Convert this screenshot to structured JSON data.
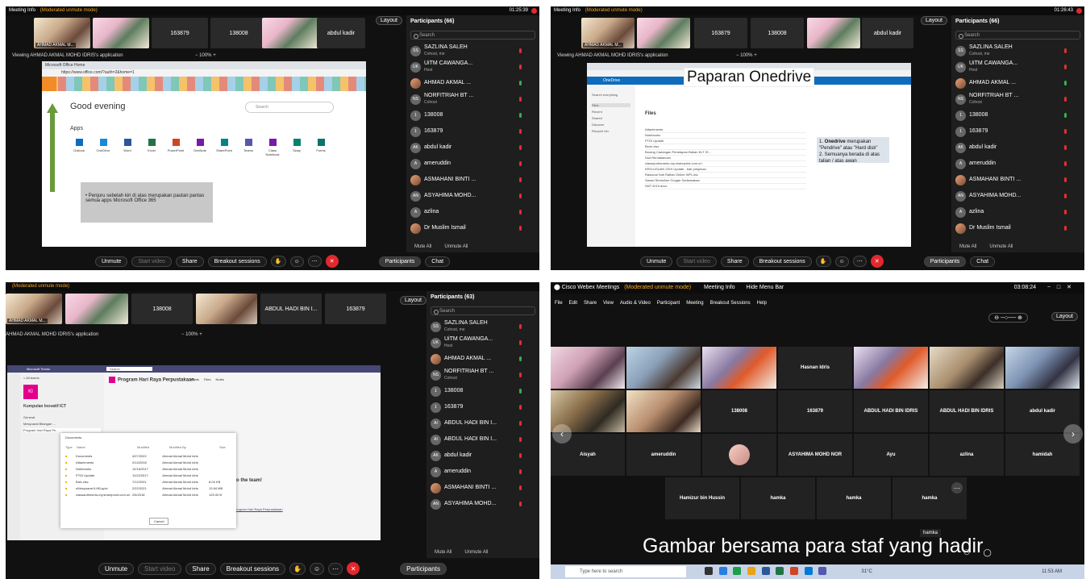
{
  "q1": {
    "title": "Meeting Info",
    "mode": "(Moderated unmute mode)",
    "clock": "01:25:39",
    "thumbs": [
      "AHMAD AKMAL M...",
      "",
      "163879",
      "138008",
      "",
      "abdul kadir"
    ],
    "layout": "Layout",
    "appline": "Viewing AHMAD AKMAL MOHD IDRIS's application",
    "zoom": "100%",
    "share": {
      "url": "https://www.office.com/?auth=2&home=1",
      "greeting": "Good evening",
      "search": "Search",
      "apps_label": "Apps",
      "apps": [
        "Outlook",
        "OneDrive",
        "Word",
        "Excel",
        "PowerPoint",
        "OneNote",
        "SharePoint",
        "Teams",
        "Class Notebook",
        "Sway",
        "Forms"
      ],
      "note": "Penjuru sebelah kiri di atas merupakan pautan pantas semua apps Microsoft Office 365"
    },
    "panel": {
      "title": "Participants (66)",
      "search": "Search",
      "people": [
        {
          "av": "SS",
          "name": "SAZLINA SALEH",
          "sub": "Cohost, me"
        },
        {
          "av": "UK",
          "name": "UiTM CAWANGA...",
          "sub": "Host"
        },
        {
          "av": "",
          "name": "AHMAD AKMAL ...",
          "sub": ""
        },
        {
          "av": "NS",
          "name": "NORFITRIAH BT ...",
          "sub": "Cohost"
        },
        {
          "av": "1",
          "name": "138008",
          "sub": ""
        },
        {
          "av": "1",
          "name": "163879",
          "sub": ""
        },
        {
          "av": "AK",
          "name": "abdul kadir",
          "sub": ""
        },
        {
          "av": "A",
          "name": "ameruddin",
          "sub": ""
        },
        {
          "av": "",
          "name": "ASMAHANI BINTI ...",
          "sub": ""
        },
        {
          "av": "AN",
          "name": "ASYAHIMA MOHD...",
          "sub": ""
        },
        {
          "av": "A",
          "name": "azlina",
          "sub": ""
        },
        {
          "av": "",
          "name": "Dr Muslim Ismail",
          "sub": ""
        }
      ],
      "muteall": "Mute All",
      "unmuteall": "Unmute All"
    },
    "ctrl": {
      "unmute": "Unmute",
      "video": "Start video",
      "share": "Share",
      "breakout": "Breakout sessions",
      "participants": "Participants",
      "chat": "Chat"
    }
  },
  "q2": {
    "title": "Meeting Info",
    "mode": "(Moderated unmute mode)",
    "clock": "01:26:43",
    "thumbs": [
      "AHMAD AKMAL M...",
      "",
      "163879",
      "138008",
      "",
      "abdul kadir"
    ],
    "layout": "Layout",
    "appline": "Viewing AHMAD AKMAL MOHD IDRIS's application",
    "zoom": "100%",
    "share": {
      "heading": "Paparan Onedrive",
      "brand": "OneDrive",
      "search": "Search everything",
      "files": "Files",
      "nav": [
        "Files",
        "Recent",
        "Shared",
        "Discover",
        "Recycle bin"
      ],
      "rows": [
        "Attachments",
        "Notebooks",
        "PTDI Update",
        "Bsrm.xlsx",
        "Borang Cadangan Penetapan Bahan KLT IS...",
        "Dsd Rendalandon",
        "classepoframedu.my.sharepoint.com.url",
        "KEKLUSUAN 2019 Update - bab pimpinan",
        "Rasional Hari Raftan Online WPI.doc",
        "Sanad Simbolion Google Sorilarsakaa",
        "SKP 2019.docx"
      ],
      "note_b1": "Onedrive",
      "note_t1": " merupakan \"Pendrive\" atau \"Hard disk\"",
      "note_l2": "2. Semuanya berada di atas talian / atas awan"
    },
    "panel": {
      "title": "Participants (66)",
      "search": "Search",
      "people": [
        {
          "av": "SS",
          "name": "SAZLINA SALEH",
          "sub": "Cohost, me"
        },
        {
          "av": "UK",
          "name": "UiTM CAWANGA...",
          "sub": "Host"
        },
        {
          "av": "",
          "name": "AHMAD AKMAL ...",
          "sub": ""
        },
        {
          "av": "NS",
          "name": "NORFITRIAH BT ...",
          "sub": "Cohost"
        },
        {
          "av": "1",
          "name": "138008",
          "sub": ""
        },
        {
          "av": "1",
          "name": "163879",
          "sub": ""
        },
        {
          "av": "AK",
          "name": "abdul kadir",
          "sub": ""
        },
        {
          "av": "A",
          "name": "ameruddin",
          "sub": ""
        },
        {
          "av": "",
          "name": "ASMAHANI BINTI ...",
          "sub": ""
        },
        {
          "av": "AN",
          "name": "ASYAHIMA MOHD...",
          "sub": ""
        },
        {
          "av": "A",
          "name": "azlina",
          "sub": ""
        },
        {
          "av": "",
          "name": "Dr Muslim Ismail",
          "sub": ""
        }
      ],
      "muteall": "Mute All",
      "unmuteall": "Unmute All"
    },
    "ctrl": {
      "unmute": "Unmute",
      "video": "Start video",
      "share": "Share",
      "breakout": "Breakout sessions",
      "participants": "Participants",
      "chat": "Chat"
    }
  },
  "q3": {
    "mode": "(Moderated unmute mode)",
    "thumbs": [
      "AHMAD AKMAL M...",
      "",
      "138008",
      "",
      "ABDUL HADI BIN I...",
      "163879"
    ],
    "layout": "Layout",
    "appline": "AHMAD AKMAL MOHD IDRIS's application",
    "zoom": "100%",
    "share": {
      "app": "Microsoft Teams",
      "search": "Search",
      "all": "< All teams",
      "team": "Kumpulan Inovatif ICT",
      "general": "General",
      "channel1": "Mesyuarat Bilangan ...",
      "channel2": "Program Hari Raya Pe...",
      "title": "Program Hari Raya Perpustakaan",
      "tabs": [
        "Posts",
        "Files",
        "Notes"
      ],
      "docs_title": "Documents",
      "cols": [
        "Type",
        "Name",
        "Modified",
        "Modified By",
        "Size"
      ],
      "rows": [
        [
          "Documents",
          "4/27/2022",
          "Ahmad Akmal Mohd Idris",
          ""
        ],
        [
          "Attachments",
          "2/14/2018",
          "Ahmad Akmal Mohd Idris",
          ""
        ],
        [
          "Notebooks",
          "12/16/2017",
          "Ahmad Akmal Mohd Idris",
          ""
        ],
        [
          "PTDI Update",
          "11/22/2017",
          "Ahmad Akmal Mohd Idris",
          ""
        ],
        [
          "Bizk.xlsx",
          "7/12/2021",
          "Ahmad Akmal Mohd Idris",
          "8.00 KB"
        ],
        [
          "eMesyuarat ILHB.pptx",
          "2/22/2021",
          "Ahmad Akmal Mohd Idris",
          "13.84 MB"
        ],
        [
          "classauthmedu-my.sharepoint.com.url",
          "2/6/2018",
          "Ahmad Akmal Mohd Idris",
          "125.00 B"
        ]
      ],
      "cancel": "Cancel",
      "team_msg": "to the team!",
      "program_link": "program Hari Raya Perpustakaan"
    },
    "panel": {
      "title": "Participants (63)",
      "search": "Search",
      "people": [
        {
          "av": "SS",
          "name": "SAZLINA SALEH",
          "sub": "Cohost, me"
        },
        {
          "av": "UK",
          "name": "UiTM CAWANGA...",
          "sub": "Host"
        },
        {
          "av": "",
          "name": "AHMAD AKMAL ...",
          "sub": ""
        },
        {
          "av": "NS",
          "name": "NORFITRIAH BT ...",
          "sub": "Cohost"
        },
        {
          "av": "1",
          "name": "138008",
          "sub": ""
        },
        {
          "av": "1",
          "name": "163879",
          "sub": ""
        },
        {
          "av": "AI",
          "name": "ABDUL HADI BIN I...",
          "sub": ""
        },
        {
          "av": "AI",
          "name": "ABDUL HADI BIN I...",
          "sub": ""
        },
        {
          "av": "AK",
          "name": "abdul kadir",
          "sub": ""
        },
        {
          "av": "A",
          "name": "ameruddin",
          "sub": ""
        },
        {
          "av": "",
          "name": "ASMAHANI BINTI ...",
          "sub": ""
        },
        {
          "av": "AN",
          "name": "ASYAHIMA MOHD...",
          "sub": ""
        }
      ],
      "muteall": "Mute All",
      "unmuteall": "Unmute All"
    },
    "ctrl": {
      "unmute": "Unmute",
      "video": "Start video",
      "share": "Share",
      "breakout": "Breakout sessions",
      "participants": "Participants"
    }
  },
  "q4": {
    "app": "Cisco Webex Meetings",
    "mode": "(Moderated unmute mode)",
    "info": "Meeting Info",
    "hide": "Hide Menu Bar",
    "clock": "03:08:24",
    "menu": [
      "File",
      "Edit",
      "Share",
      "View",
      "Audio & Video",
      "Participant",
      "Meeting",
      "Breakout Sessions",
      "Help"
    ],
    "layout": "Layout",
    "row1": [
      "",
      "",
      "",
      "Hasnan Idris",
      "",
      "",
      ""
    ],
    "row2": [
      "",
      "",
      "138008",
      "163879",
      "ABDUL HADI BIN IDRIS",
      "ABDUL HADI BIN IDRIS",
      "abdul kadir"
    ],
    "row3": [
      "Aisyah",
      "ameruddin",
      "",
      "ASYAHIMA MOHD NOR",
      "Ayu",
      "azlina",
      "hamidah"
    ],
    "row4": [
      "Hamizur bin Hussin",
      "hamka",
      "hamka",
      "hamka"
    ],
    "tooltip": "hamka",
    "caption": "Gambar bersama para staf yang hadir",
    "taskbar": {
      "search": "Type here to search",
      "temp": "31°C",
      "time": "11:53 AM"
    }
  }
}
